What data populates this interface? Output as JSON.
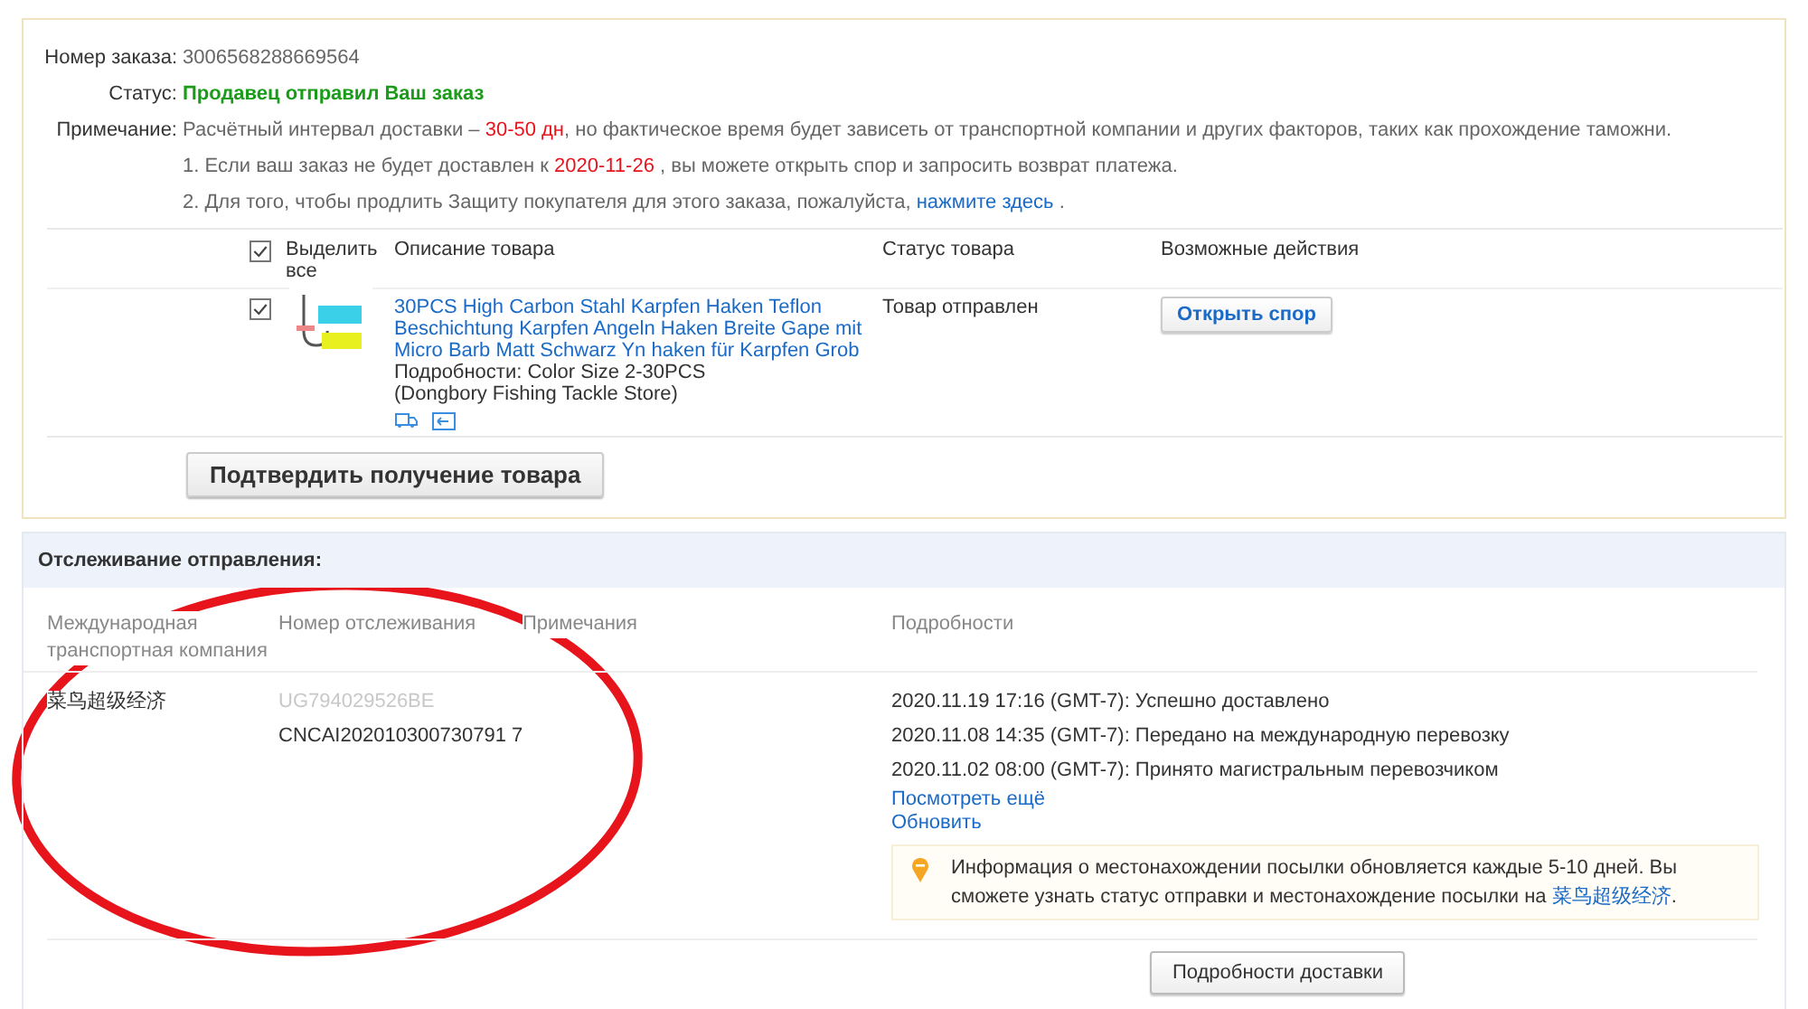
{
  "order": {
    "fields": [
      {
        "label": "Номер заказа:",
        "kind": "plain",
        "value": "3006568288669564"
      },
      {
        "label": "Статус:",
        "kind": "status",
        "value": "Продавец отправил Ваш заказ"
      }
    ],
    "note": {
      "label": "Примечание:",
      "lines": [
        [
          {
            "kind": "text",
            "text": "Расчётный интервал доставки – "
          },
          {
            "kind": "highlight",
            "text": "30-50 дн"
          },
          {
            "kind": "text",
            "text": ", но фактическое время будет зависеть от транспортной компании и других факторов, таких как прохождение таможни."
          }
        ],
        [
          {
            "kind": "text",
            "text": "1. Если ваш заказ не будет доставлен к "
          },
          {
            "kind": "highlight",
            "text": "2020-11-26"
          },
          {
            "kind": "text",
            "text": " , вы можете открыть спор и запросить возврат платежа."
          }
        ],
        [
          {
            "kind": "text",
            "text": "2. Для того, чтобы продлить Защиту покупателя для этого заказа, пожалуйста, "
          },
          {
            "kind": "link",
            "text": "нажмите здесь"
          },
          {
            "kind": "text",
            "text": " ."
          }
        ]
      ]
    },
    "table": {
      "select_all": {
        "label": "Выделить все",
        "checked": true
      },
      "columns": [
        "Описание товара",
        "Статус товара",
        "Возможные действия"
      ],
      "rows": [
        {
          "checked": true,
          "title": "30PCS High Carbon Stahl Karpfen Haken Teflon Beschichtung Karpfen Angeln Haken Breite Gape mit Micro Barb Matt Schwarz Yn haken für Karpfen Grob",
          "details": "Подробности: Color Size 2-30PCS",
          "store": "(Dongbory Fishing Tackle Store)",
          "status": "Товар отправлен",
          "action": "Открыть спор"
        }
      ]
    },
    "confirm_button": "Подтвердить получение товара"
  },
  "tracking": {
    "title": "Отслеживание отправления:",
    "columns": [
      "Международная транспортная компания",
      "Номер отслеживания",
      "Примечания",
      "Подробности"
    ],
    "carrier": "菜鸟超级经济",
    "old_number": "UG794029526BE",
    "number": "CNCAI202010300730791 7",
    "events": [
      "2020.11.19 17:16 (GMT-7): Успешно доставлено",
      "2020.11.08 14:35 (GMT-7): Передано на международную перевозку",
      "2020.11.02 08:00 (GMT-7): Принято магистральным перевозчиком"
    ],
    "more_link": "Посмотреть ещё",
    "refresh_link": "Обновить",
    "info": [
      {
        "kind": "text",
        "text": "Информация о местонахождении посылки обновляется каждые 5-10 дней. Вы сможете узнать статус отправки и местонахождение посылки на "
      },
      {
        "kind": "link",
        "text": "菜鸟超级经济"
      },
      {
        "kind": "text",
        "text": "."
      }
    ],
    "details_button": "Подробности доставки"
  }
}
